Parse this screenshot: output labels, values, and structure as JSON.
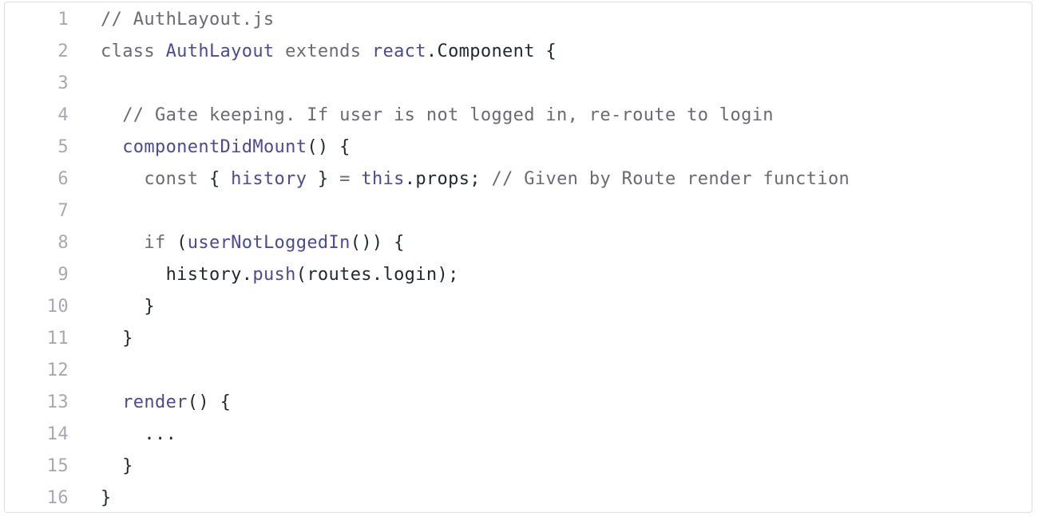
{
  "editor": {
    "colors": {
      "comment": "#6a6a72",
      "keyword": "#6b6b73",
      "name": "#4b4a94",
      "plain": "#24292e",
      "line_number": "#a8a8b0",
      "border": "#dddddd"
    },
    "lines": [
      {
        "n": "1",
        "tokens": [
          {
            "t": "// AuthLayout.js",
            "k": "comment"
          }
        ]
      },
      {
        "n": "2",
        "tokens": [
          {
            "t": "class ",
            "k": "keyword"
          },
          {
            "t": "AuthLayout",
            "k": "name"
          },
          {
            "t": " extends ",
            "k": "keyword"
          },
          {
            "t": "react",
            "k": "name"
          },
          {
            "t": ".Component {",
            "k": "plain"
          }
        ]
      },
      {
        "n": "3",
        "tokens": []
      },
      {
        "n": "4",
        "tokens": [
          {
            "t": "  // Gate keeping. If user is not logged in, re-route to login",
            "k": "comment"
          }
        ]
      },
      {
        "n": "5",
        "tokens": [
          {
            "t": "  ",
            "k": "plain"
          },
          {
            "t": "componentDidMount",
            "k": "name"
          },
          {
            "t": "() {",
            "k": "plain"
          }
        ]
      },
      {
        "n": "6",
        "tokens": [
          {
            "t": "    const",
            "k": "keyword"
          },
          {
            "t": " { ",
            "k": "plain"
          },
          {
            "t": "history",
            "k": "name"
          },
          {
            "t": " } ",
            "k": "plain"
          },
          {
            "t": "=",
            "k": "keyword"
          },
          {
            "t": " ",
            "k": "plain"
          },
          {
            "t": "this",
            "k": "name"
          },
          {
            "t": ".props; ",
            "k": "plain"
          },
          {
            "t": "// Given by Route render function",
            "k": "comment"
          }
        ]
      },
      {
        "n": "7",
        "tokens": []
      },
      {
        "n": "8",
        "tokens": [
          {
            "t": "    if",
            "k": "keyword"
          },
          {
            "t": " (",
            "k": "plain"
          },
          {
            "t": "userNotLoggedIn",
            "k": "name"
          },
          {
            "t": "()) {",
            "k": "plain"
          }
        ]
      },
      {
        "n": "9",
        "tokens": [
          {
            "t": "      history.",
            "k": "plain"
          },
          {
            "t": "push",
            "k": "name"
          },
          {
            "t": "(routes.login);",
            "k": "plain"
          }
        ]
      },
      {
        "n": "10",
        "tokens": [
          {
            "t": "    }",
            "k": "plain"
          }
        ]
      },
      {
        "n": "11",
        "tokens": [
          {
            "t": "  }",
            "k": "plain"
          }
        ]
      },
      {
        "n": "12",
        "tokens": []
      },
      {
        "n": "13",
        "tokens": [
          {
            "t": "  ",
            "k": "plain"
          },
          {
            "t": "render",
            "k": "name"
          },
          {
            "t": "() {",
            "k": "plain"
          }
        ]
      },
      {
        "n": "14",
        "tokens": [
          {
            "t": "    ...",
            "k": "plain"
          }
        ]
      },
      {
        "n": "15",
        "tokens": [
          {
            "t": "  }",
            "k": "plain"
          }
        ]
      },
      {
        "n": "16",
        "tokens": [
          {
            "t": "}",
            "k": "plain"
          }
        ]
      }
    ]
  }
}
